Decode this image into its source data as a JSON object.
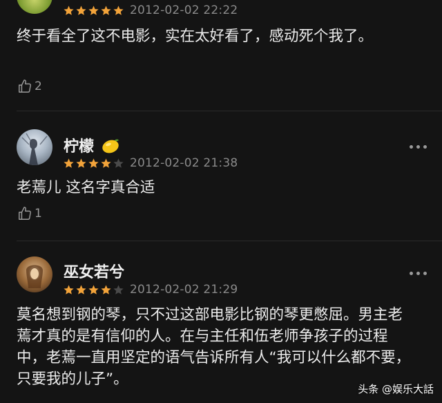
{
  "comments": [
    {
      "username": "",
      "rating": 5,
      "date": "2012-02-02 22:22",
      "text": "终于看全了这不电影，实在太好看了，感动死个我了。",
      "likes": "2"
    },
    {
      "username": "柠檬",
      "emoji": "lemon-emoji",
      "rating": 4,
      "date": "2012-02-02 21:38",
      "text": "老蔫儿  这名字真合适",
      "likes": "1"
    },
    {
      "username": "巫女若兮",
      "rating": 4,
      "date": "2012-02-02 21:29",
      "text": "莫名想到钢的琴，只不过这部电影比钢的琴更憋屈。男主老蔫才真的是有信仰的人。在与主任和伍老师争孩子的过程中，老蔫一直用坚定的语气告诉所有人“我可以什么都不要，只要我的儿子”。"
    }
  ],
  "colors": {
    "star_filled": "#f2a33a",
    "star_empty": "#4a4a4a",
    "background": "#141414"
  },
  "watermark": {
    "platform": "头条",
    "account": "@娱乐大話"
  }
}
